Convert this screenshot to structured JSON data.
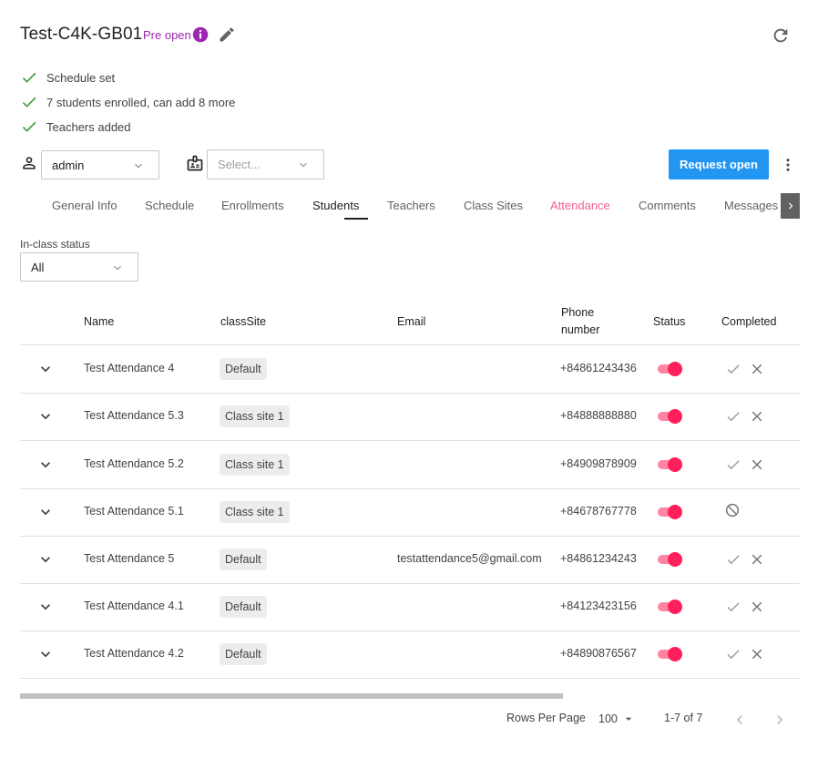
{
  "header": {
    "title": "Test-C4K-GB01",
    "status_badge": "Pre open",
    "info_icon": "info-icon",
    "edit_icon": "pencil-icon",
    "refresh_icon": "refresh-icon",
    "badge_color": "#9c27b0"
  },
  "checklist": [
    {
      "label": "Schedule set",
      "icon": "check-icon"
    },
    {
      "label": "7 students enrolled, can add 8 more",
      "icon": "check-icon"
    },
    {
      "label": "Teachers added",
      "icon": "check-icon"
    }
  ],
  "filters": {
    "user_select": {
      "value": "admin",
      "icon": "person-icon"
    },
    "role_select": {
      "placeholder": "Select...",
      "icon": "id-card-icon"
    }
  },
  "actions": {
    "request_open_label": "Request open",
    "primary_color": "#2196f3",
    "more_icon": "more-vert-icon"
  },
  "tabs": [
    {
      "label": "General Info"
    },
    {
      "label": "Schedule"
    },
    {
      "label": "Enrollments"
    },
    {
      "label": "Students",
      "active": true
    },
    {
      "label": "Teachers"
    },
    {
      "label": "Class Sites"
    },
    {
      "label": "Attendance",
      "highlight": "#f06292"
    },
    {
      "label": "Comments"
    },
    {
      "label": "Messages"
    }
  ],
  "in_class_filter": {
    "label": "In-class status",
    "value": "All"
  },
  "table": {
    "columns": {
      "name": "Name",
      "classSite": "classSite",
      "email": "Email",
      "phone_line1": "Phone",
      "phone_line2": "number",
      "status": "Status",
      "completed": "Completed"
    },
    "rows": [
      {
        "name": "Test Attendance 4",
        "classSite": "Default",
        "email": "",
        "phone": "+84861243436",
        "status": true,
        "completed": "check-x"
      },
      {
        "name": "Test Attendance 5.3",
        "classSite": "Class site 1",
        "email": "",
        "phone": "+84888888880",
        "status": true,
        "completed": "check-x"
      },
      {
        "name": "Test Attendance 5.2",
        "classSite": "Class site 1",
        "email": "",
        "phone": "+84909878909",
        "status": true,
        "completed": "check-x"
      },
      {
        "name": "Test Attendance 5.1",
        "classSite": "Class site 1",
        "email": "",
        "phone": "+84678767778",
        "status": true,
        "completed": "blocked"
      },
      {
        "name": "Test Attendance 5",
        "classSite": "Default",
        "email": "testattendance5@gmail.com",
        "phone": "+84861234243",
        "status": true,
        "completed": "check-x"
      },
      {
        "name": "Test Attendance 4.1",
        "classSite": "Default",
        "email": "",
        "phone": "+84123423156",
        "status": true,
        "completed": "check-x"
      },
      {
        "name": "Test Attendance 4.2",
        "classSite": "Default",
        "email": "",
        "phone": "+84890876567",
        "status": true,
        "completed": "check-x"
      }
    ],
    "toggle_color": "#ff1f5a"
  },
  "pagination": {
    "rows_per_page_label": "Rows Per Page",
    "rows_per_page_value": "100",
    "range": "1-7 of 7"
  }
}
